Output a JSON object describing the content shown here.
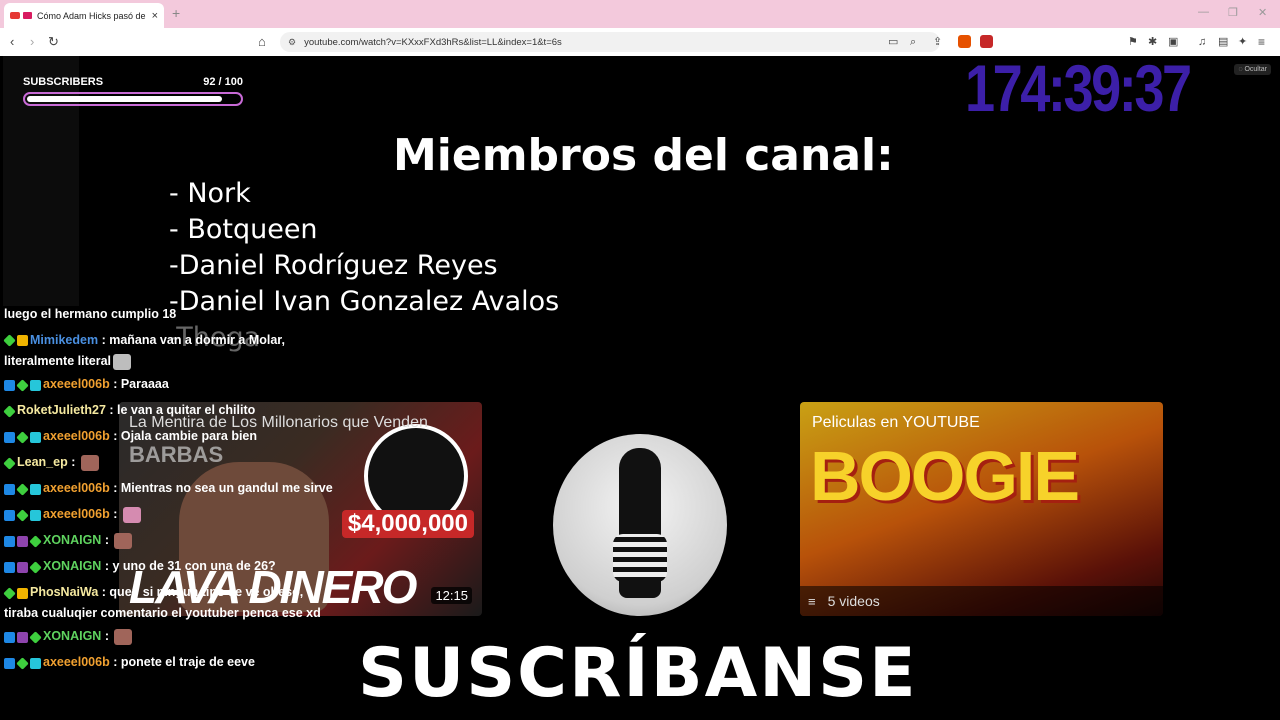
{
  "browser": {
    "tab_title": "Cómo Adam Hicks pasó de E",
    "tab_close": "×",
    "new_tab": "+",
    "url": "youtube.com/watch?v=KXxxFXd3hRs&list=LL&index=1&t=6s",
    "window_controls": [
      "—",
      "❐",
      "✕"
    ]
  },
  "overlay": {
    "subscribers_label": "SUBSCRIBERS",
    "subscribers_count": "92  / 100",
    "subscribers_progress": 0.92,
    "timer": "174:39:37",
    "hide_label": "Ocultar"
  },
  "slide": {
    "title": "Miembros del canal:",
    "members": [
      "- Nork",
      "- Botqueen",
      "-Daniel Rodríguez Reyes",
      "-Daniel Ivan Gonzalez Avalos",
      "-Thega"
    ],
    "subscribe_text": "SUSCRÍBANSE"
  },
  "end_cards": {
    "left": {
      "title": "La Mentira de Los Millonarios que Venden",
      "overlay_word": "BARBAS",
      "amount": "$4,000,000",
      "big_word": "LAVA DINERO",
      "duration": "12:15"
    },
    "right": {
      "title": "Peliculas en YOUTUBE",
      "big_word": "BOOGIE",
      "playlist_count": "5 videos"
    }
  },
  "chat": [
    {
      "badges": [],
      "user": "",
      "user_color": "#ffffff",
      "text": "luego el hermano cumplio 18",
      "emote": ""
    },
    {
      "badges": [
        "green",
        "gold"
      ],
      "user": "Mimikedem",
      "user_color": "#4a90e2",
      "text": " : mañana van a dormir a Molar, literalmente literal",
      "emote": "cat"
    },
    {
      "badges": [
        "blue",
        "green",
        "teal"
      ],
      "user": "axeeel006b",
      "user_color": "#f0a030",
      "text": " : Paraaaa",
      "emote": ""
    },
    {
      "badges": [
        "green"
      ],
      "user": "RoketJulieth27",
      "user_color": "#f5e9a0",
      "text": " : le van a quitar el chilito",
      "emote": ""
    },
    {
      "badges": [
        "blue",
        "green",
        "teal"
      ],
      "user": "axeeel006b",
      "user_color": "#f0a030",
      "text": " : Ojala cambie para bien",
      "emote": ""
    },
    {
      "badges": [
        "green"
      ],
      "user": "Lean_ep",
      "user_color": "#f5e9a0",
      "text": " : ",
      "emote": "face"
    },
    {
      "badges": [
        "blue",
        "green",
        "teal"
      ],
      "user": "axeeel006b",
      "user_color": "#f0a030",
      "text": " : Mientras no sea un gandul me sirve",
      "emote": ""
    },
    {
      "badges": [
        "blue",
        "green",
        "teal"
      ],
      "user": "axeeel006b",
      "user_color": "#f0a030",
      "text": " : ",
      "emote": "pink"
    },
    {
      "badges": [
        "blue",
        "purple",
        "green"
      ],
      "user": "XONAIGN",
      "user_color": "#5fd35f",
      "text": " : ",
      "emote": "face"
    },
    {
      "badges": [
        "blue",
        "purple",
        "green"
      ],
      "user": "XONAIGN",
      "user_color": "#5fd35f",
      "text": " : y uno de 31 con una de 26?",
      "emote": ""
    },
    {
      "badges": [
        "green",
        "gold"
      ],
      "user": "PhosNaiWa",
      "user_color": "#f5e9a0",
      "text": " : que? si ningun tipo se ve obeso, tiraba cualuqier comentario el youtuber penca ese xd",
      "emote": ""
    },
    {
      "badges": [
        "blue",
        "purple",
        "green"
      ],
      "user": "XONAIGN",
      "user_color": "#5fd35f",
      "text": " : ",
      "emote": "face"
    },
    {
      "badges": [
        "blue",
        "green",
        "teal"
      ],
      "user": "axeeel006b",
      "user_color": "#f0a030",
      "text": " : ponete el traje de eeve",
      "emote": ""
    }
  ]
}
